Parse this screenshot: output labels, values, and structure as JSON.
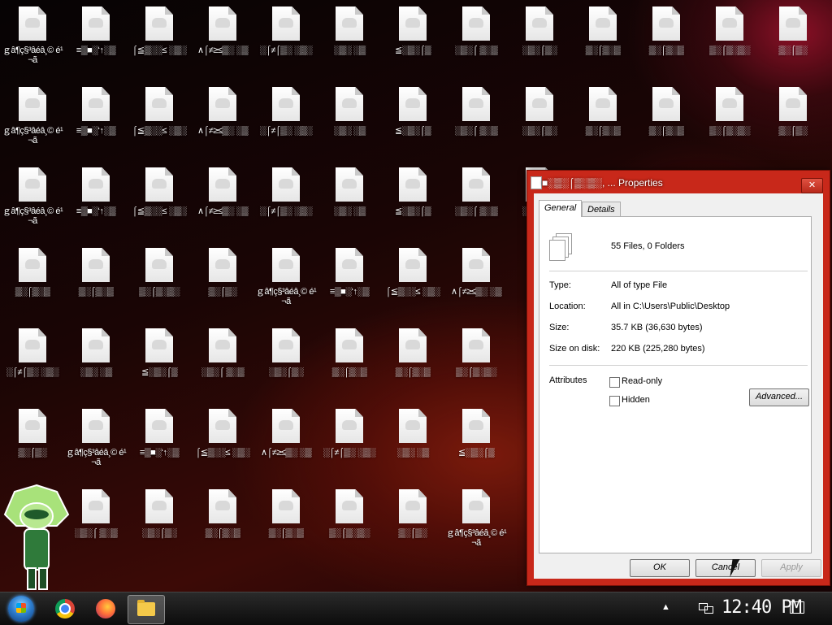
{
  "desktop": {
    "icons": [
      {
        "label": "ｇâ¶ç§³âéâ¸© é¹¬ã"
      },
      {
        "label": "≡▒■░‘↑░▒"
      },
      {
        "label": "⌠≦▒░░≤ ░▒░"
      },
      {
        "label": "∧⌠≠≥≤▒░ ░▒"
      },
      {
        "label": "░⌠≠⌠▒░ ░▒░"
      },
      {
        "label": "░▒░ ░▒"
      },
      {
        "label": "≦░▒░⌠▒"
      },
      {
        "label": "░▒░⌠ ▒░▒"
      },
      {
        "label": "░▒░⌠▒░"
      },
      {
        "label": "▒░⌠▒░▒"
      },
      {
        "label": "▒░⌠▒░▒"
      },
      {
        "label": "▒░⌠▒░▒░"
      },
      {
        "label": "▒░⌠▒░"
      }
    ],
    "row_count": 7
  },
  "dialog": {
    "title": "■░▒░⌠▒░▒░, ... Properties",
    "close_label": "✕",
    "tabs": [
      "General",
      "Details"
    ],
    "summary": "55 Files, 0 Folders",
    "fields": [
      {
        "label": "Type:",
        "value": "All of type File"
      },
      {
        "label": "Location:",
        "value": "All in C:\\Users\\Public\\Desktop"
      },
      {
        "label": "Size:",
        "value": "35.7 KB (36,630 bytes)"
      },
      {
        "label": "Size on disk:",
        "value": "220 KB (225,280 bytes)"
      }
    ],
    "attributes_label": "Attributes",
    "readonly_label": "Read-only",
    "hidden_label": "Hidden",
    "advanced_label": "Advanced...",
    "ok_label": "OK",
    "cancel_label": "Cancel",
    "apply_label": "Apply"
  },
  "taskbar": {
    "clock": "12:40 PM",
    "tray_up": "▲"
  }
}
